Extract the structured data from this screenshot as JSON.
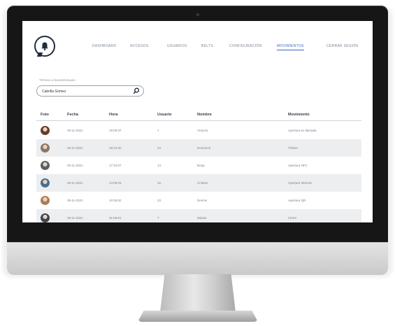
{
  "nav": {
    "items": [
      "DASHBOARD",
      "ACCESOS",
      "USUARIOS",
      "BELTS",
      "CONFIGURACIÓN",
      "MOVIMIENTOS",
      "CERRAR SESIÓN"
    ],
    "active_index": 5,
    "accent_color": "#3a66c8"
  },
  "search": {
    "label": "Término a buscar/Usuario",
    "value": "Cabrilla Gomez"
  },
  "table": {
    "headers": [
      "Foto",
      "Fecha",
      "Hora",
      "Usuario",
      "Nombre",
      "Movimiento"
    ],
    "rows": [
      {
        "fecha": "29-11-2021",
        "hora": "19:09:37",
        "usuario": "1",
        "nombre": "Antonio",
        "movimiento": "Apertura en llamada",
        "avatar_color": "#6b3b2a"
      },
      {
        "fecha": "29-11-2021",
        "hora": "18:12:00",
        "usuario": "24",
        "nombre": "Rosmerie",
        "movimiento": "Timbre",
        "avatar_color": "#8a7868"
      },
      {
        "fecha": "29-11-2021",
        "hora": "17:10:07",
        "usuario": "14",
        "nombre": "Borja",
        "movimiento": "Apertura NFC",
        "avatar_color": "#5a5f66"
      },
      {
        "fecha": "29-11-2021",
        "hora": "14:09:23",
        "usuario": "15",
        "nombre": "Cristian",
        "movimiento": "Apertura Internet",
        "avatar_color": "#4c6e8c"
      },
      {
        "fecha": "29-11-2021",
        "hora": "10:25:02",
        "usuario": "23",
        "nombre": "Dennis",
        "movimiento": "Apertura QR",
        "avatar_color": "#b07a55"
      },
      {
        "fecha": "29-11-2021",
        "hora": "01:06:51",
        "usuario": "7",
        "nombre": "Miriam",
        "movimiento": "Cierre",
        "avatar_color": "#3f4652"
      }
    ]
  }
}
